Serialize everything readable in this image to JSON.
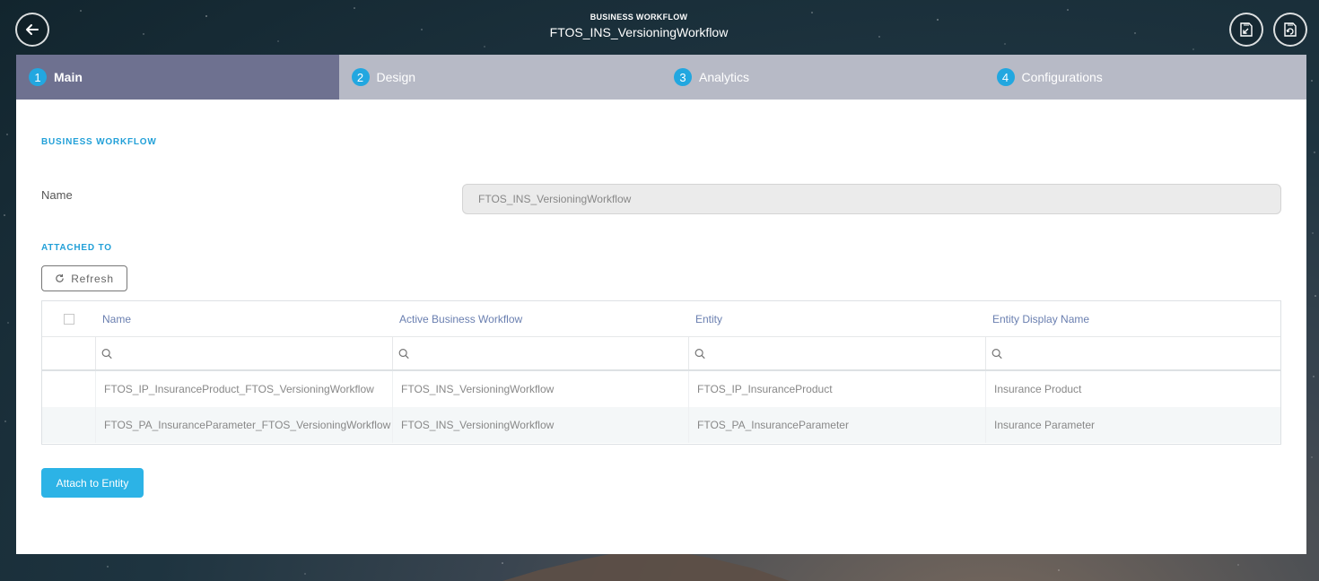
{
  "header": {
    "subtitle": "BUSINESS WORKFLOW",
    "title": "FTOS_INS_VersioningWorkflow"
  },
  "tabs": [
    {
      "number": "1",
      "label": "Main",
      "active": true
    },
    {
      "number": "2",
      "label": "Design",
      "active": false
    },
    {
      "number": "3",
      "label": "Analytics",
      "active": false
    },
    {
      "number": "4",
      "label": "Configurations",
      "active": false
    }
  ],
  "main": {
    "section_title": "BUSINESS WORKFLOW",
    "name_label": "Name",
    "name_value": "FTOS_INS_VersioningWorkflow",
    "attached_title": "ATTACHED TO",
    "refresh_label": "Refresh",
    "attach_button_label": "Attach to Entity"
  },
  "table": {
    "columns": [
      "Name",
      "Active Business Workflow",
      "Entity",
      "Entity Display Name"
    ],
    "rows": [
      {
        "name": "FTOS_IP_InsuranceProduct_FTOS_VersioningWorkflow",
        "active_workflow": "FTOS_INS_VersioningWorkflow",
        "entity": "FTOS_IP_InsuranceProduct",
        "display_name": "Insurance Product"
      },
      {
        "name": "FTOS_PA_InsuranceParameter_FTOS_VersioningWorkflow",
        "active_workflow": "FTOS_INS_VersioningWorkflow",
        "entity": "FTOS_PA_InsuranceParameter",
        "display_name": "Insurance Parameter"
      }
    ]
  },
  "icons": {
    "back": "arrow-left-icon",
    "export": "export-file-icon",
    "import": "import-file-icon",
    "refresh": "refresh-icon",
    "filter": "search-icon"
  },
  "colors": {
    "accent": "#22a7e0",
    "active_tab": "#6e7190",
    "inactive_tab": "#b7bac6",
    "section_title": "#22a0d8",
    "column_header": "#6a7fb0",
    "attach_button": "#2cb3e6"
  }
}
